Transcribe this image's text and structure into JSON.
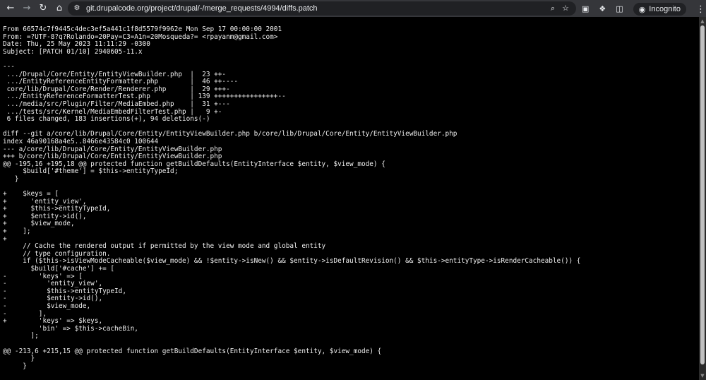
{
  "browser": {
    "url": "git.drupalcode.org/project/drupal/-/merge_requests/4994/diffs.patch",
    "incognito_label": "Incognito",
    "icons": {
      "back": "arrow-left-icon",
      "forward": "arrow-right-icon",
      "reload": "reload-icon",
      "home": "home-icon",
      "site_info": "tune-icon",
      "zoom": "zoom-icon",
      "bookmark": "star-icon",
      "cast": "cast-icon",
      "extensions": "puzzle-icon",
      "side_panel": "side-panel-icon",
      "menu": "kebab-menu-icon"
    },
    "colors": {
      "toolbar": "#35363a",
      "omnibox": "#202124",
      "page_bg": "#000000",
      "text": "#f0f0f0"
    }
  },
  "patch": {
    "lines": [
      "From 66574c7f9445c4dec3ef5a441c1f8d5579f9962e Mon Sep 17 00:00:00 2001",
      "From: =?UTF-8?q?Rolando=20Pay=C3=A1n=20Mosqueda?= <rpayanm@gmail.com>",
      "Date: Thu, 25 May 2023 11:11:29 -0300",
      "Subject: [PATCH 01/10] 2940605-11.x",
      "",
      "---",
      " .../Drupal/Core/Entity/EntityViewBuilder.php  |  23 ++-",
      " .../EntityReferenceEntityFormatter.php        |  46 ++----",
      " core/lib/Drupal/Core/Render/Renderer.php      |  29 +++-",
      " .../EntityReferenceFormatterTest.php          | 139 ++++++++++++++++--",
      " .../media/src/Plugin/Filter/MediaEmbed.php    |  31 +---",
      " .../tests/src/Kernel/MediaEmbedFilterTest.php |   9 +-",
      " 6 files changed, 183 insertions(+), 94 deletions(-)",
      "",
      "diff --git a/core/lib/Drupal/Core/Entity/EntityViewBuilder.php b/core/lib/Drupal/Core/Entity/EntityViewBuilder.php",
      "index 46a90168a4e5..8466e43584c0 100644",
      "--- a/core/lib/Drupal/Core/Entity/EntityViewBuilder.php",
      "+++ b/core/lib/Drupal/Core/Entity/EntityViewBuilder.php",
      "@@ -195,16 +195,18 @@ protected function getBuildDefaults(EntityInterface $entity, $view_mode) {",
      "     $build['#theme'] = $this->entityTypeId;",
      "   }",
      "",
      "+    $keys = [",
      "+      'entity_view',",
      "+      $this->entityTypeId,",
      "+      $entity->id(),",
      "+      $view_mode,",
      "+    ];",
      "+",
      "     // Cache the rendered output if permitted by the view mode and global entity",
      "     // type configuration.",
      "     if ($this->isViewModeCacheable($view_mode) && !$entity->isNew() && $entity->isDefaultRevision() && $this->entityType->isRenderCacheable()) {",
      "       $build['#cache'] += [",
      "-        'keys' => [",
      "-          'entity_view',",
      "-          $this->entityTypeId,",
      "-          $entity->id(),",
      "-          $view_mode,",
      "-        ],",
      "+        'keys' => $keys,",
      "         'bin' => $this->cacheBin,",
      "       ];",
      "",
      "@@ -213,6 +215,15 @@ protected function getBuildDefaults(EntityInterface $entity, $view_mode) {",
      "       }",
      "     }"
    ]
  }
}
